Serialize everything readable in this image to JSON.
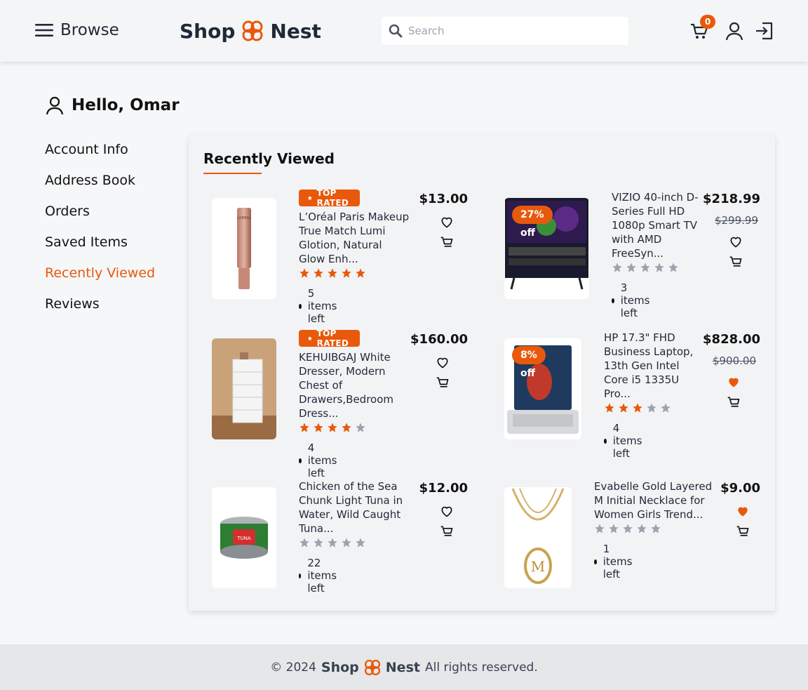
{
  "header": {
    "browse_label": "Browse",
    "brand_left": "Shop",
    "brand_right": "Nest",
    "search_placeholder": "Search",
    "cart_count": "0",
    "accent": "#e8590c"
  },
  "greeting": "Hello, Omar",
  "sidebar": {
    "items": [
      {
        "label": "Account Info"
      },
      {
        "label": "Address Book"
      },
      {
        "label": "Orders"
      },
      {
        "label": "Saved Items"
      },
      {
        "label": "Recently Viewed",
        "active": true
      },
      {
        "label": "Reviews"
      }
    ]
  },
  "panel": {
    "title": "Recently Viewed",
    "products": [
      {
        "name": "L’Oréal Paris Makeup True Match Lumi Glotion, Natural Glow Enh...",
        "badge": "TOP RATED",
        "price": "$13.00",
        "rating": 5,
        "stock": "5 items left",
        "favorited": false
      },
      {
        "name": "VIZIO 40-inch D-Series Full HD 1080p Smart TV with AMD FreeSyn...",
        "discount": "27% off",
        "price": "$218.99",
        "old_price": "$299.99",
        "rating": 0,
        "stock": "3 items left",
        "favorited": false
      },
      {
        "name": "KEHUIBGAJ White Dresser, Modern Chest of Drawers,Bedroom Dress...",
        "badge": "TOP RATED",
        "price": "$160.00",
        "rating": 4,
        "stock": "4 items left",
        "favorited": false
      },
      {
        "name": "HP 17.3\" FHD Business Laptop, 13th Gen Intel Core i5 1335U Pro...",
        "discount": "8% off",
        "price": "$828.00",
        "old_price": "$900.00",
        "rating": 3,
        "stock": "4 items left",
        "favorited": true
      },
      {
        "name": "Chicken of the Sea Chunk Light Tuna in Water, Wild Caught Tuna...",
        "price": "$12.00",
        "rating": 0,
        "stock": "22 items left",
        "favorited": false
      },
      {
        "name": "Evabelle Gold Layered M Initial Necklace for Women Girls Trend...",
        "price": "$9.00",
        "rating": 0,
        "stock": "1 items left",
        "favorited": true
      }
    ]
  },
  "footer": {
    "copyright": "© 2024",
    "brand_left": "Shop",
    "brand_right": "Nest",
    "rights": "All rights reserved."
  }
}
